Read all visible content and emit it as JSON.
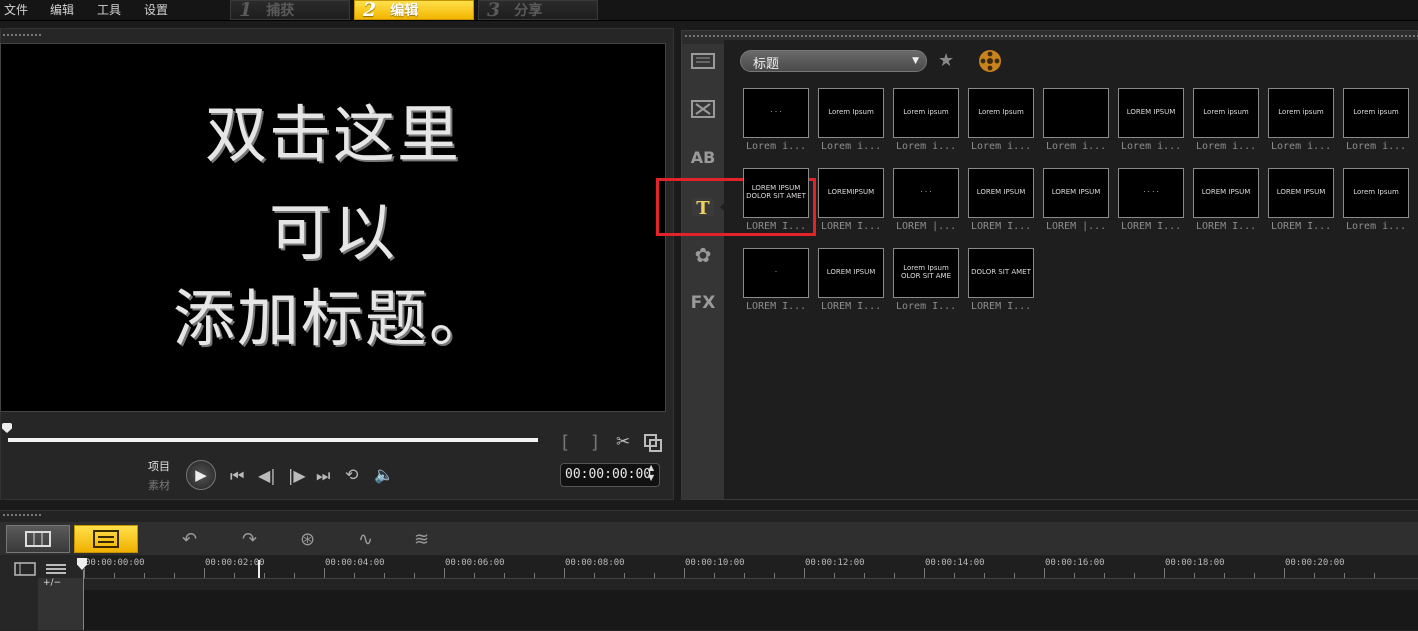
{
  "menu": [
    "文件",
    "编辑",
    "工具",
    "设置"
  ],
  "steps": [
    {
      "num": "1",
      "label": "捕获"
    },
    {
      "num": "2",
      "label": "编辑"
    },
    {
      "num": "3",
      "label": "分享"
    }
  ],
  "preview": {
    "lines": [
      "双击这里",
      "可以",
      "添加标题。"
    ]
  },
  "controls": {
    "mode_project": "项目",
    "mode_clip": "素材",
    "timecode": "00:00:00:00",
    "bracket_in": "[",
    "bracket_out": "]"
  },
  "library": {
    "category": "标题",
    "titles": [
      {
        "thumb": "· · ·",
        "label": "Lorem i..."
      },
      {
        "thumb": "Lorem Ipsum",
        "label": "Lorem i..."
      },
      {
        "thumb": "Lorem ipsum",
        "label": "Lorem i..."
      },
      {
        "thumb": "Lorem Ipsum",
        "label": "Lorem i..."
      },
      {
        "thumb": "",
        "label": "Lorem i..."
      },
      {
        "thumb": "LOREM IPSUM",
        "label": "Lorem i..."
      },
      {
        "thumb": "Lorem ipsum",
        "label": "Lorem i..."
      },
      {
        "thumb": "Lorem ipsum",
        "label": "Lorem i..."
      },
      {
        "thumb": "Lorem ipsum",
        "label": "Lorem i..."
      },
      {
        "thumb": "LOREM IPSUM DOLOR SIT AMET",
        "label": "LOREM I..."
      },
      {
        "thumb": "LOREMIPSUM",
        "label": "LOREM I..."
      },
      {
        "thumb": "· · ·",
        "label": "LOREM |..."
      },
      {
        "thumb": "LOREM IPSUM",
        "label": "LOREM I..."
      },
      {
        "thumb": "LOREM IPSUM",
        "label": "LOREM |..."
      },
      {
        "thumb": "· · · ·",
        "label": "LOREM I..."
      },
      {
        "thumb": "LOREM IPSUM",
        "label": "LOREM I..."
      },
      {
        "thumb": "LOREM IPSUM",
        "label": "LOREM I..."
      },
      {
        "thumb": "Lorem Ipsum",
        "label": "Lorem i..."
      },
      {
        "thumb": "·",
        "label": "LOREM I..."
      },
      {
        "thumb": "LOREM IPSUM",
        "label": "LOREM I..."
      },
      {
        "thumb": "Lorem Ipsum OLOR SIT AME",
        "label": "Lorem I..."
      },
      {
        "thumb": "DOLOR SIT AMET",
        "label": "LOREM I..."
      }
    ]
  },
  "timeline": {
    "ticks": [
      "00:00:00:00",
      "00:00:02:00",
      "00:00:04:00",
      "00:00:06:00",
      "00:00:08:00",
      "00:00:10:00",
      "00:00:12:00",
      "00:00:14:00",
      "00:00:16:00",
      "00:00:18:00",
      "00:00:20:00"
    ],
    "zoom_label": "+/−"
  },
  "colors": {
    "accent": "#f3b500",
    "highlight": "#e3232a",
    "preview_bg": "#000000"
  },
  "icons": [
    "video-capture-icon",
    "transition-icon",
    "ab-icon",
    "title-icon",
    "graphics-icon",
    "fx-icon",
    "star-add-icon",
    "film-reel-icon"
  ]
}
